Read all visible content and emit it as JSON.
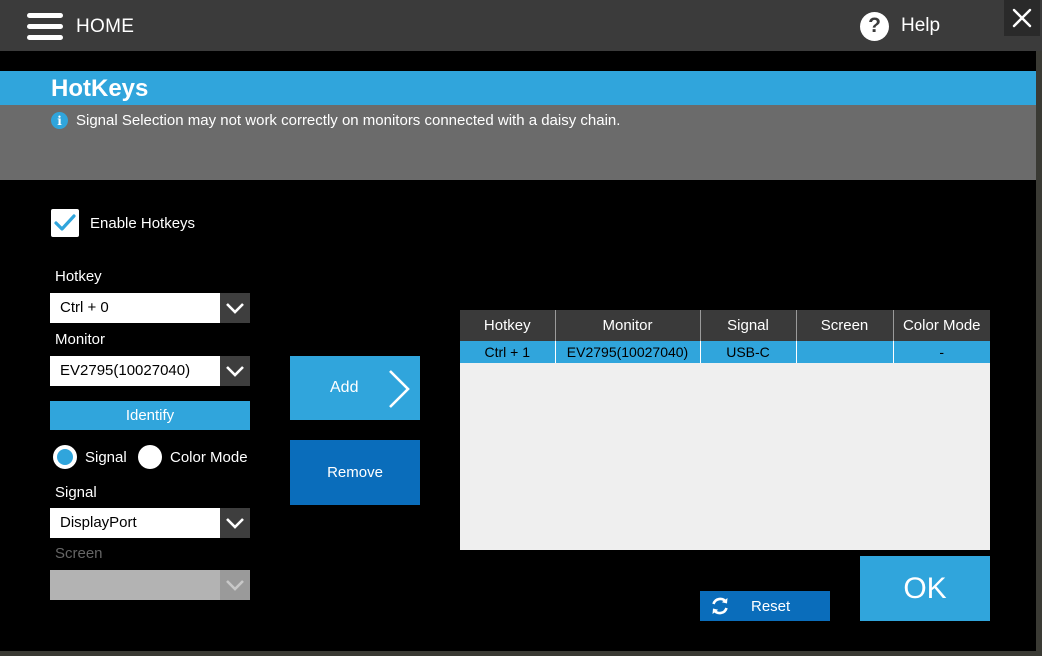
{
  "titlebar": {
    "home_label": "HOME",
    "help_label": "Help",
    "help_glyph": "?",
    "close_glyph": "×"
  },
  "banner": {
    "title": "HotKeys",
    "info_glyph": "i",
    "info_text": "Signal Selection may not work correctly on monitors connected with a daisy chain."
  },
  "form": {
    "enable_label": "Enable Hotkeys",
    "enable_checked": true,
    "hotkey_label": "Hotkey",
    "hotkey_value": "Ctrl + 0",
    "monitor_label": "Monitor",
    "monitor_value": "EV2795(10027040)",
    "identify_label": "Identify",
    "radio_signal_label": "Signal",
    "radio_color_label": "Color Mode",
    "radio_selected": "Signal",
    "signal_label": "Signal",
    "signal_value": "DisplayPort",
    "screen_label": "Screen",
    "screen_value": ""
  },
  "actions": {
    "add_label": "Add",
    "remove_label": "Remove",
    "reset_label": "Reset",
    "ok_label": "OK"
  },
  "table": {
    "columns": [
      "Hotkey",
      "Monitor",
      "Signal",
      "Screen",
      "Color Mode"
    ],
    "rows": [
      [
        "Ctrl + 1",
        "EV2795(10027040)",
        "USB-C",
        "",
        "-"
      ]
    ]
  },
  "colors": {
    "accent": "#30a5dc",
    "dark_blue": "#0a6dbb",
    "titlebar": "#3b3b3b",
    "panel": "#000000",
    "gray_banner": "#6b6b6b"
  }
}
